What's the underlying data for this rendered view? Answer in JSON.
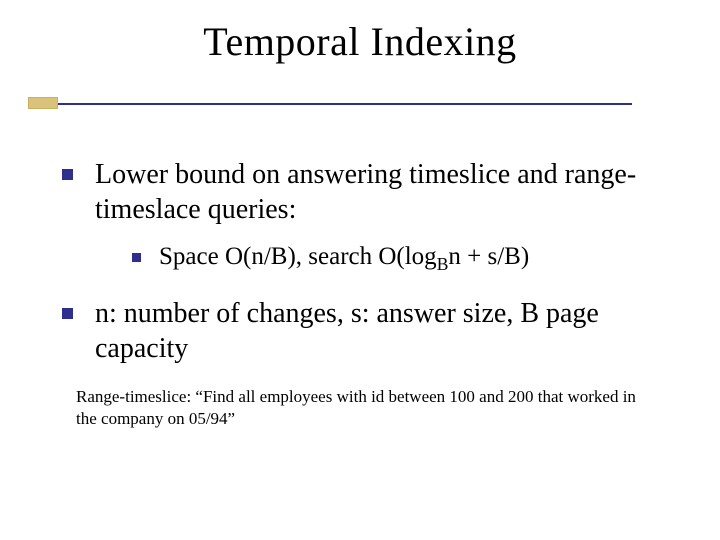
{
  "title": "Temporal Indexing",
  "bullets": {
    "b1": "Lower bound on answering timeslice  and range-timeslace queries:",
    "b1_1_prefix": "Space O(n/B), search O(log",
    "b1_1_sub": "B",
    "b1_1_suffix": "n + s/B)",
    "b2": "n: number of changes, s: answer size, B page capacity"
  },
  "footnote": "Range-timeslice: “Find all employees with id between 100 and 200 that worked in the company on 05/94”"
}
